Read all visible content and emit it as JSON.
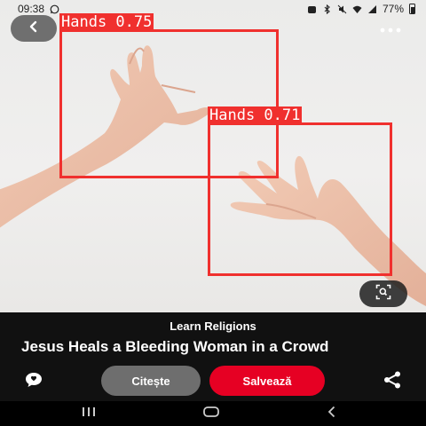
{
  "status_bar": {
    "time": "09:38",
    "battery": "77%",
    "icons": [
      "whatsapp-icon",
      "notification-icon",
      "bluetooth-icon",
      "mute-icon",
      "wifi-icon",
      "signal-icon",
      "battery-icon"
    ]
  },
  "overlay": {
    "back_icon": "chevron-left-icon",
    "more_icon": "more-dots-icon",
    "lens_icon": "visual-search-icon"
  },
  "detections": [
    {
      "label": "Hands 0.75"
    },
    {
      "label": "Hands 0.71"
    }
  ],
  "pin": {
    "source": "Learn Religions",
    "title": "Jesus Heals a Bleeding Woman in a Crowd"
  },
  "actions": {
    "read_label": "Citește",
    "save_label": "Salvează",
    "comment_icon": "comment-icon",
    "share_icon": "share-icon"
  },
  "nav": {
    "icons": [
      "recent-apps-icon",
      "home-icon",
      "back-nav-icon"
    ]
  },
  "colors": {
    "save_red": "#e60023",
    "detection_red": "#f0302e",
    "read_gray": "#6e6e6e"
  }
}
